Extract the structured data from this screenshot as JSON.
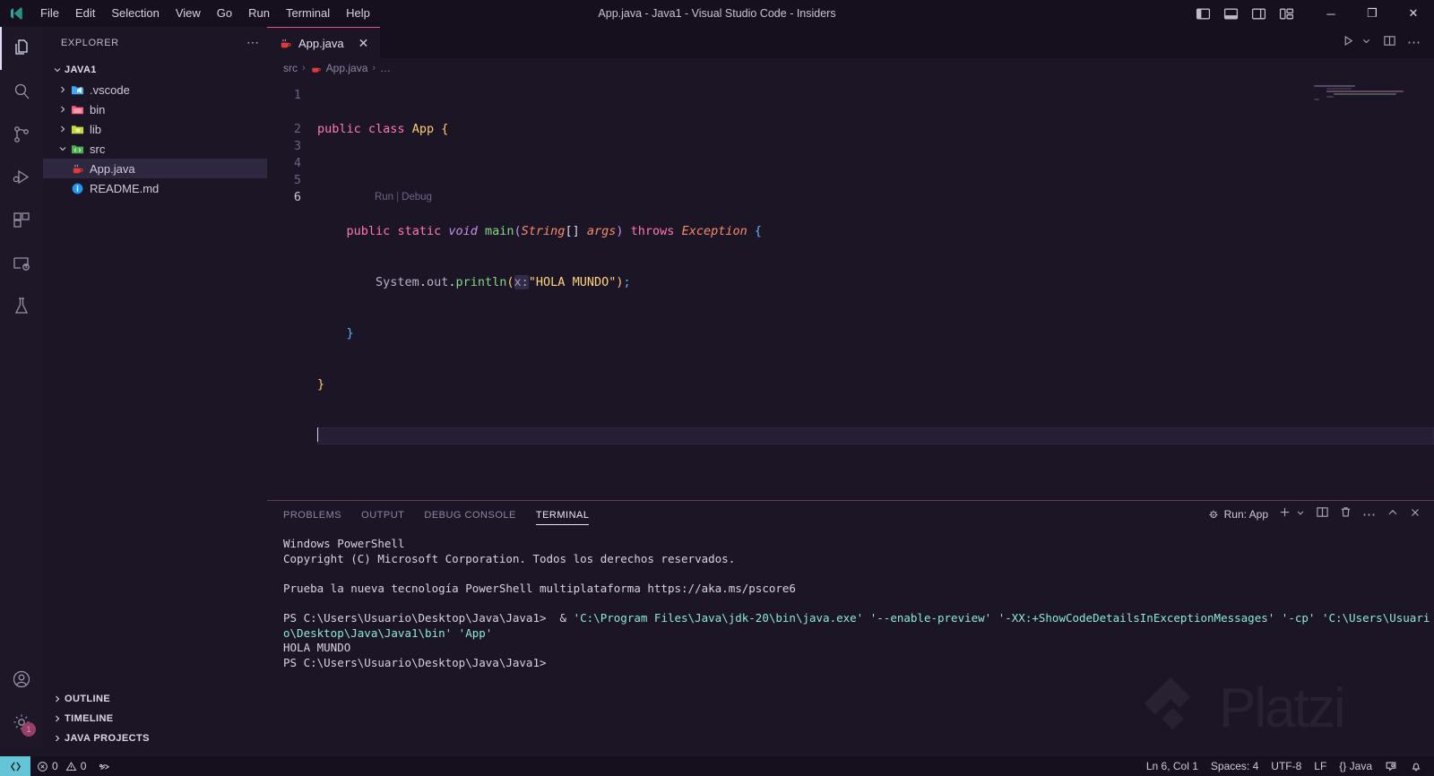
{
  "window": {
    "title": "App.java - Java1 - Visual Studio Code - Insiders",
    "menus": [
      "File",
      "Edit",
      "Selection",
      "View",
      "Go",
      "Run",
      "Terminal",
      "Help"
    ],
    "layout_icons": [
      "toggle-primary-sidebar-icon",
      "toggle-panel-icon",
      "toggle-secondary-sidebar-icon",
      "customize-layout-icon"
    ],
    "controls": {
      "minimize": "─",
      "maximize": "❐",
      "close": "✕"
    }
  },
  "activitybar": {
    "items": [
      {
        "name": "explorer",
        "icon": "files-icon",
        "active": true
      },
      {
        "name": "search",
        "icon": "search-icon",
        "active": false
      },
      {
        "name": "source-control",
        "icon": "source-control-icon",
        "active": false
      },
      {
        "name": "run-and-debug",
        "icon": "run-debug-icon",
        "active": false
      },
      {
        "name": "extensions",
        "icon": "extensions-icon",
        "active": false
      },
      {
        "name": "remote-explorer",
        "icon": "remote-explorer-icon",
        "active": false
      },
      {
        "name": "testing",
        "icon": "beaker-icon",
        "active": false
      }
    ],
    "bottom": [
      {
        "name": "accounts",
        "icon": "account-icon",
        "badge": ""
      },
      {
        "name": "manage",
        "icon": "gear-icon",
        "badge": "1"
      }
    ]
  },
  "sidebar": {
    "header": "EXPLORER",
    "more_actions": "⋯",
    "tree": [
      {
        "label": "JAVA1",
        "type": "root",
        "expanded": true,
        "indent": 0
      },
      {
        "label": ".vscode",
        "type": "folder",
        "icon": "vscode-folder-icon",
        "expanded": false,
        "indent": 1
      },
      {
        "label": "bin",
        "type": "folder",
        "icon": "bin-folder-icon",
        "expanded": false,
        "indent": 1
      },
      {
        "label": "lib",
        "type": "folder",
        "icon": "lib-folder-icon",
        "expanded": false,
        "indent": 1
      },
      {
        "label": "src",
        "type": "folder",
        "icon": "src-folder-icon",
        "expanded": true,
        "indent": 1
      },
      {
        "label": "App.java",
        "type": "file",
        "icon": "java-file-icon",
        "selected": true,
        "indent": 2
      },
      {
        "label": "README.md",
        "type": "file",
        "icon": "markdown-info-icon",
        "selected": false,
        "indent": 1
      }
    ],
    "sections": [
      "OUTLINE",
      "TIMELINE",
      "JAVA PROJECTS"
    ]
  },
  "editor": {
    "tab": {
      "label": "App.java",
      "icon": "java-file-icon",
      "close": "✕"
    },
    "tab_actions": [
      "run-icon",
      "chevron-down-icon",
      "split-editor-icon",
      "more-actions-icon"
    ],
    "breadcrumbs": [
      "src",
      "App.java",
      "…"
    ],
    "codelens": {
      "run": "Run",
      "separator": "|",
      "debug": "Debug"
    },
    "line_numbers": [
      "1",
      "2",
      "3",
      "4",
      "5",
      "6"
    ],
    "active_line": "6",
    "lines": [
      [
        {
          "t": "public",
          "c": "t-key"
        },
        {
          "t": " ",
          "c": "t-plain"
        },
        {
          "t": "class",
          "c": "t-key"
        },
        {
          "t": " ",
          "c": "t-plain"
        },
        {
          "t": "App",
          "c": "t-cls"
        },
        {
          "t": " ",
          "c": "t-plain"
        },
        {
          "t": "{",
          "c": "t-brace-y"
        }
      ],
      [
        {
          "t": "    ",
          "c": "t-plain"
        },
        {
          "t": "public",
          "c": "t-key"
        },
        {
          "t": " ",
          "c": "t-plain"
        },
        {
          "t": "static",
          "c": "t-key"
        },
        {
          "t": " ",
          "c": "t-plain"
        },
        {
          "t": "void",
          "c": "t-key2"
        },
        {
          "t": " ",
          "c": "t-plain"
        },
        {
          "t": "main",
          "c": "t-fn"
        },
        {
          "t": "(",
          "c": "t-brace-p"
        },
        {
          "t": "String",
          "c": "t-type"
        },
        {
          "t": "[]",
          "c": "t-plain"
        },
        {
          "t": " ",
          "c": "t-plain"
        },
        {
          "t": "args",
          "c": "t-var"
        },
        {
          "t": ")",
          "c": "t-brace-p"
        },
        {
          "t": " ",
          "c": "t-plain"
        },
        {
          "t": "throws",
          "c": "t-key"
        },
        {
          "t": " ",
          "c": "t-plain"
        },
        {
          "t": "Exception",
          "c": "t-type"
        },
        {
          "t": " ",
          "c": "t-plain"
        },
        {
          "t": "{",
          "c": "t-brace-b"
        }
      ],
      [
        {
          "t": "        ",
          "c": "t-plain"
        },
        {
          "t": "System",
          "c": "t-obj"
        },
        {
          "t": ".",
          "c": "t-plain"
        },
        {
          "t": "out",
          "c": "t-obj"
        },
        {
          "t": ".",
          "c": "t-plain"
        },
        {
          "t": "println",
          "c": "t-fn"
        },
        {
          "t": "(",
          "c": "t-brace-y"
        },
        {
          "t": "x:",
          "c": "t-param"
        },
        {
          "t": "\"HOLA MUNDO\"",
          "c": "t-str"
        },
        {
          "t": ")",
          "c": "t-brace-y"
        },
        {
          "t": ";",
          "c": "t-brace-b"
        }
      ],
      [
        {
          "t": "    ",
          "c": "t-plain"
        },
        {
          "t": "}",
          "c": "t-brace-b"
        }
      ],
      [
        {
          "t": "}",
          "c": "t-brace-y"
        }
      ],
      []
    ]
  },
  "panel": {
    "tabs": [
      "PROBLEMS",
      "OUTPUT",
      "DEBUG CONSOLE",
      "TERMINAL"
    ],
    "active_tab": "TERMINAL",
    "terminal_selector": "Run: App",
    "actions": [
      "new-terminal-icon",
      "chevron-down-icon",
      "split-terminal-icon",
      "kill-terminal-icon",
      "more-actions-icon",
      "maximize-panel-icon",
      "close-panel-icon"
    ],
    "terminal_lines": [
      [
        {
          "t": "Windows PowerShell",
          "c": "tm-white"
        }
      ],
      [
        {
          "t": "Copyright (C) Microsoft Corporation. Todos los derechos reservados.",
          "c": "tm-white"
        }
      ],
      [],
      [
        {
          "t": "Prueba la nueva tecnología PowerShell multiplataforma https://aka.ms/pscore6",
          "c": "tm-white"
        }
      ],
      [],
      [
        {
          "t": "PS C:\\Users\\Usuario\\Desktop\\Java\\Java1>",
          "c": "tm-white"
        },
        {
          "t": "  & ",
          "c": "tm-white"
        },
        {
          "t": "'C:\\Program Files\\Java\\jdk-20\\bin\\java.exe' '--enable-preview' '-XX:+ShowCodeDetailsInExceptionMessages' '-cp' 'C:\\Users\\Usuario\\Desktop\\Java\\Java1\\bin' 'App'",
          "c": "tm-cyan"
        }
      ],
      [
        {
          "t": "HOLA MUNDO",
          "c": "tm-white"
        }
      ],
      [
        {
          "t": "PS C:\\Users\\Usuario\\Desktop\\Java\\Java1>",
          "c": "tm-white"
        }
      ]
    ]
  },
  "statusbar": {
    "remote_icon": "remote-window-icon",
    "errors": "0",
    "warnings": "0",
    "ports_icon": "ports-icon",
    "right": [
      {
        "name": "cursor-position",
        "label": "Ln 6, Col 1"
      },
      {
        "name": "indentation",
        "label": "Spaces: 4"
      },
      {
        "name": "encoding",
        "label": "UTF-8"
      },
      {
        "name": "eol",
        "label": "LF"
      },
      {
        "name": "language-mode",
        "label": "{} Java"
      }
    ],
    "feedback_icon": "feedback-icon",
    "notifications_icon": "bell-icon"
  },
  "watermark": {
    "text": "Platzi"
  },
  "colors": {
    "accent_pink": "#e4568f",
    "editor_bg": "#1b1526",
    "titlebar_bg": "#150f1e",
    "activitybar_bg": "#1d1727",
    "remote_badge": "#63c5d6"
  }
}
